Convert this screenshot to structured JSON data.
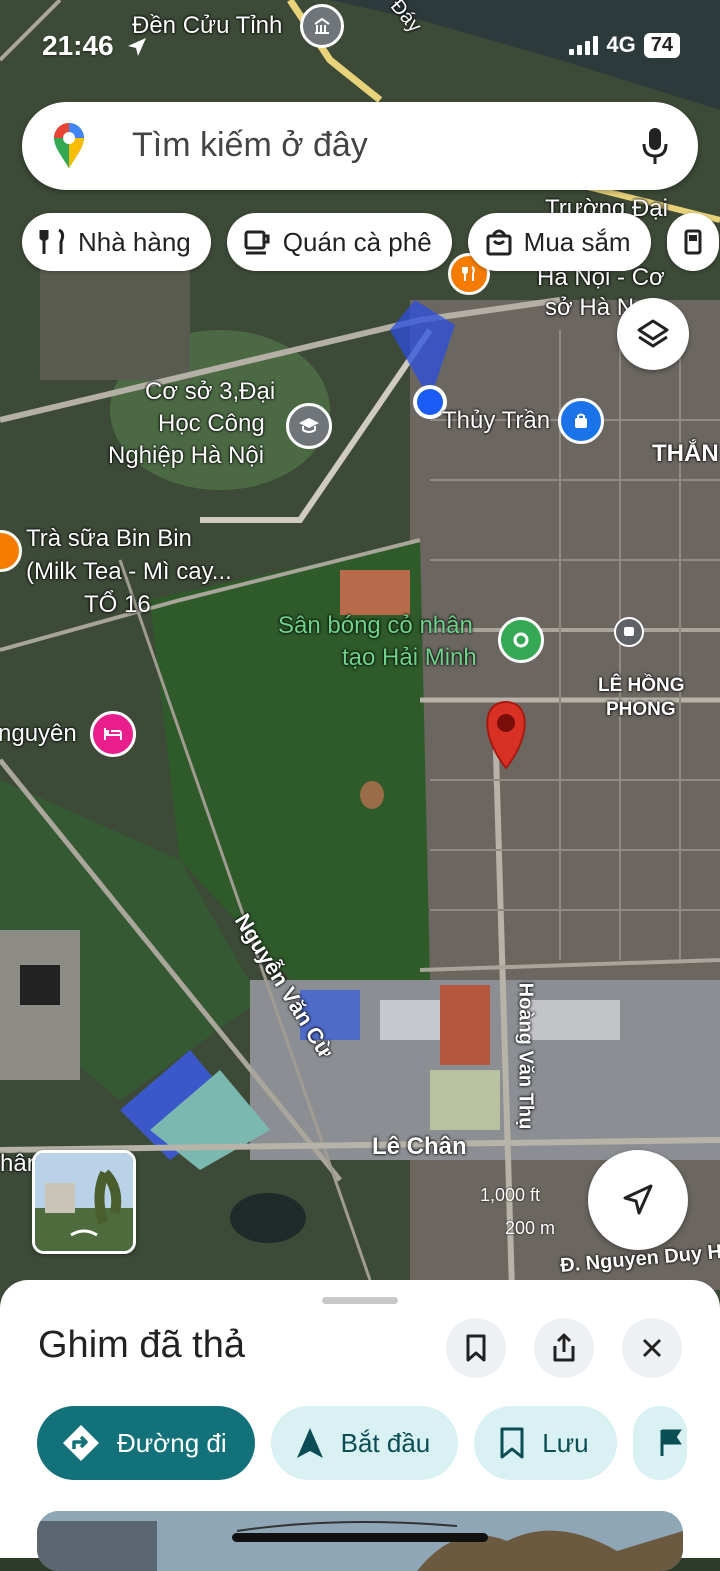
{
  "status": {
    "time": "21:46",
    "network": "4G",
    "battery": "74"
  },
  "search": {
    "placeholder": "Tìm kiếm ở đây"
  },
  "chips": [
    {
      "label": "Nhà hàng",
      "icon": "fork-knife-icon"
    },
    {
      "label": "Quán cà phê",
      "icon": "coffee-cup-icon"
    },
    {
      "label": "Mua sắm",
      "icon": "shopping-bag-icon"
    }
  ],
  "map": {
    "labels": {
      "den_cuu_tinh": "Đền Cửu Tỉnh",
      "river_fragment": "Đáy",
      "truong_dai_1": "Trường Đại",
      "truong_dai_2": "Hà Nội - Cơ",
      "truong_dai_3": "sở Hà N",
      "co_so_1": "Cơ sở 3,Đại",
      "co_so_2": "Học Công",
      "co_so_3": "Nghiệp Hà Nội",
      "thuy_tran": "Thủy Trần",
      "thang": "THẮN",
      "tra_sua_1": "Trà sữa Bin Bin",
      "tra_sua_2": "(Milk Tea - Mì cay...",
      "to_16": "TỔ 16",
      "san_bong_1": "Sân bóng cỏ nhân",
      "san_bong_2": "tạo Hải Minh",
      "le_hong_phong_1": "LÊ HỒNG",
      "le_hong_phong_2": "PHONG",
      "nguyen": "nguyên",
      "nguyen_van_cu": "Nguyễn Văn Cừ",
      "hoang_van_thu": "Hoàng Văn Thụ",
      "le_chan": "Lê Chân",
      "nhan_fragment": "hân",
      "nguyen_duy": "Đ. Nguyen Duy H"
    },
    "scale_top": "1,000 ft",
    "scale_bottom": "200 m"
  },
  "sheet": {
    "title": "Ghim đã thả",
    "actions": [
      {
        "label": "Đường đi",
        "icon": "directions-icon"
      },
      {
        "label": "Bắt đầu",
        "icon": "navigation-arrow-icon"
      },
      {
        "label": "Lưu",
        "icon": "bookmark-icon"
      }
    ]
  },
  "colors": {
    "primary": "#13717a",
    "secondary": "#d9f1f3",
    "pin": "#d93025",
    "location": "#1a5cf5"
  }
}
